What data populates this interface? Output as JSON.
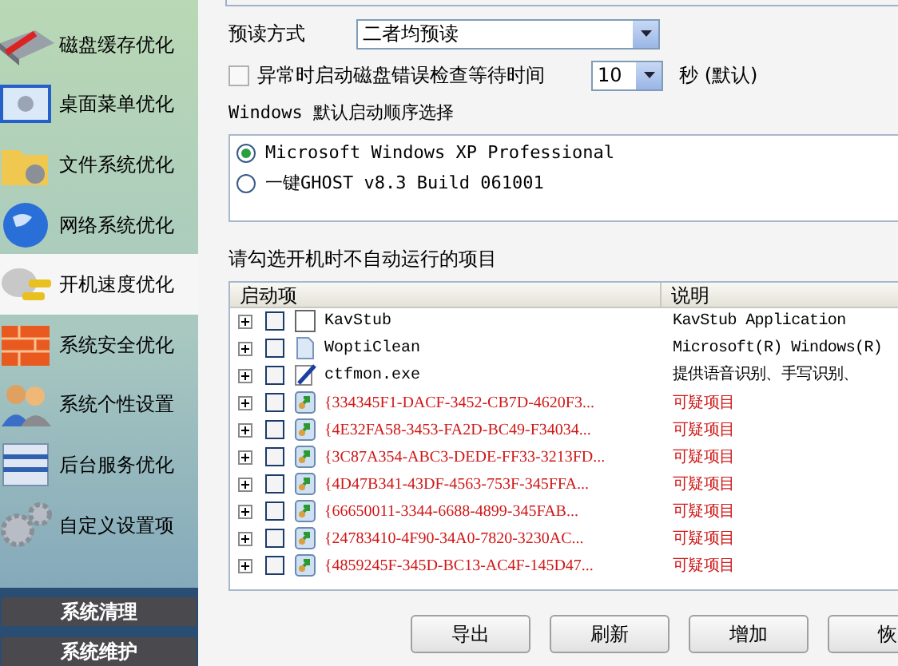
{
  "sidebar": {
    "items": [
      {
        "label": "磁盘缓存优化",
        "selected": false
      },
      {
        "label": "桌面菜单优化",
        "selected": false
      },
      {
        "label": "文件系统优化",
        "selected": false
      },
      {
        "label": "网络系统优化",
        "selected": false
      },
      {
        "label": "开机速度优化",
        "selected": true
      },
      {
        "label": "系统安全优化",
        "selected": false
      },
      {
        "label": "系统个性设置",
        "selected": false
      },
      {
        "label": "后台服务优化",
        "selected": false
      },
      {
        "label": "自定义设置项",
        "selected": false
      }
    ],
    "sections": [
      "系统清理",
      "系统维护"
    ]
  },
  "prefetch": {
    "label": "预读方式",
    "value": "二者均预读"
  },
  "disk_check": {
    "label": "异常时启动磁盘错误检查等待时间",
    "checked": false,
    "value": "10",
    "unit": "秒 (默认)"
  },
  "boot_order": {
    "title": "Windows 默认启动顺序选择",
    "options": [
      {
        "label": "Microsoft Windows XP Professional",
        "selected": true
      },
      {
        "label": "一键GHOST v8.3 Build 061001",
        "selected": false
      }
    ]
  },
  "startup": {
    "title": "请勾选开机时不自动运行的项目",
    "columns": [
      "启动项",
      "说明"
    ],
    "rows": [
      {
        "name": "KavStub",
        "description": "KavStub Application",
        "kind": "blank",
        "checked": false
      },
      {
        "name": "WoptiClean",
        "description": "Microsoft(R) Windows(R)",
        "kind": "doc",
        "checked": false
      },
      {
        "name": "ctfmon.exe",
        "description": "提供语音识别、手写识别、",
        "kind": "pen",
        "checked": false
      },
      {
        "name": "{334345F1-DACF-3452-CB7D-4620F3...",
        "description": "可疑项目",
        "kind": "suspect",
        "checked": false
      },
      {
        "name": "{4E32FA58-3453-FA2D-BC49-F34034...",
        "description": "可疑项目",
        "kind": "suspect",
        "checked": false
      },
      {
        "name": "{3C87A354-ABC3-DEDE-FF33-3213FD...",
        "description": "可疑项目",
        "kind": "suspect",
        "checked": false
      },
      {
        "name": "{4D47B341-43DF-4563-753F-345FFA...",
        "description": "可疑项目",
        "kind": "suspect",
        "checked": false
      },
      {
        "name": "{66650011-3344-6688-4899-345FAB...",
        "description": "可疑项目",
        "kind": "suspect",
        "checked": false
      },
      {
        "name": "{24783410-4F90-34A0-7820-3230AC...",
        "description": "可疑项目",
        "kind": "suspect",
        "checked": false
      },
      {
        "name": "{4859245F-345D-BC13-AC4F-145D47...",
        "description": "可疑项目",
        "kind": "suspect",
        "checked": false
      }
    ]
  },
  "buttons": [
    "导出",
    "刷新",
    "增加",
    "恢"
  ]
}
